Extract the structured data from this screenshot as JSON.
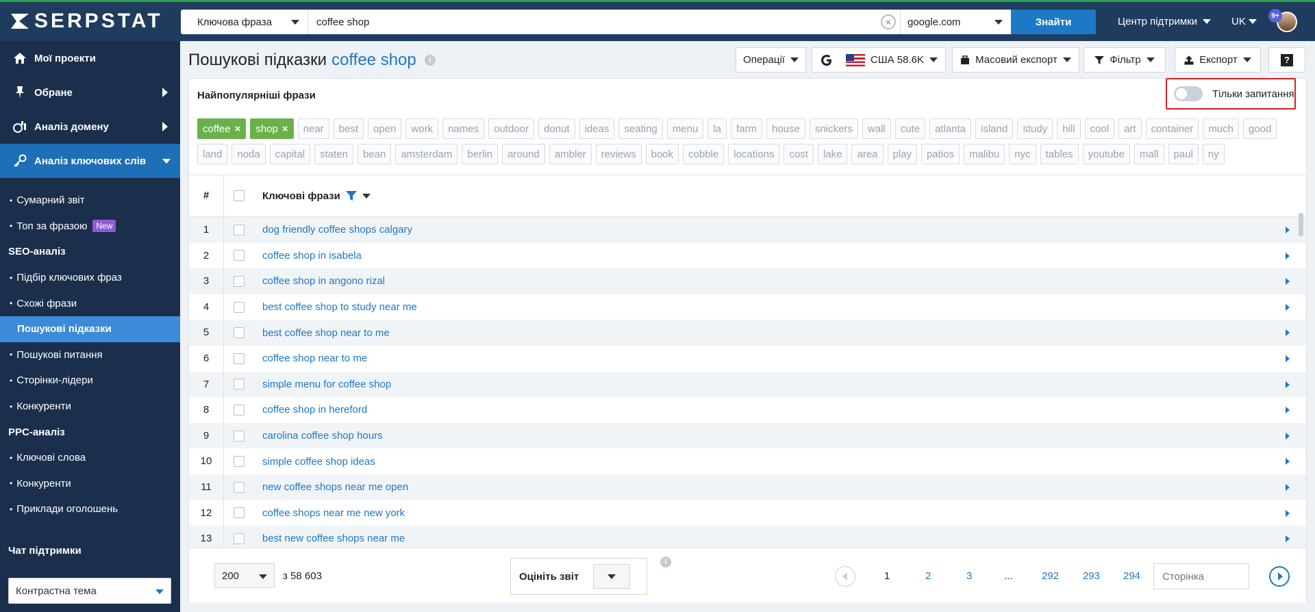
{
  "app": {
    "logo": "SERPSTAT"
  },
  "search": {
    "type": "Ключова фраза",
    "query": "coffee shop",
    "engine": "google.com",
    "button": "Знайти"
  },
  "topnav": {
    "support": "Центр підтримки",
    "lang": "UK",
    "notifications": "9+"
  },
  "sidebar": {
    "main": [
      {
        "label": "Мої проекти",
        "icon": "home-icon"
      },
      {
        "label": "Обране",
        "icon": "pin-icon"
      },
      {
        "label": "Аналіз домену",
        "icon": "chart-icon"
      },
      {
        "label": "Аналіз ключових слів",
        "icon": "key-icon"
      }
    ],
    "sub": [
      {
        "label": "Сумарний звіт"
      },
      {
        "label": "Топ за фразою",
        "badge": "New"
      },
      {
        "group": "SEO-аналіз"
      },
      {
        "label": "Підбір ключових фраз"
      },
      {
        "label": "Схожі фрази"
      },
      {
        "label": "Пошукові підказки",
        "active": true
      },
      {
        "label": "Пошукові питання"
      },
      {
        "label": "Сторінки-лідери"
      },
      {
        "label": "Конкуренти"
      },
      {
        "group": "PPC-аналіз"
      },
      {
        "label": "Ключові слова"
      },
      {
        "label": "Конкуренти"
      },
      {
        "label": "Приклади оголошень"
      }
    ],
    "chat": "Чат підтримки",
    "theme": "Контрастна тема"
  },
  "page": {
    "title": "Пошукові підказки",
    "keyword": "coffee shop",
    "toolbar": {
      "operations": "Операції",
      "region": "США 58.6K",
      "mass_export": "Масовий експорт",
      "filter": "Фільтр",
      "export": "Експорт",
      "help": "?"
    }
  },
  "card": {
    "heading": "Найпопулярніші фрази",
    "toggle_label": "Тільки запитання",
    "selected_tags": [
      "coffee",
      "shop"
    ],
    "tags_row1": [
      "near",
      "best",
      "open",
      "work",
      "names",
      "outdoor",
      "donut",
      "ideas",
      "seating",
      "menu",
      "la",
      "farm",
      "house",
      "snickers",
      "wall",
      "cute",
      "atlanta",
      "island",
      "study",
      "hill",
      "cool",
      "art",
      "container",
      "much",
      "good"
    ],
    "tags_row2": [
      "land",
      "noda",
      "capital",
      "staten",
      "bean",
      "amsterdam",
      "berlin",
      "around",
      "ambler",
      "reviews",
      "book",
      "cobble",
      "locations",
      "cost",
      "lake",
      "area",
      "play",
      "patios",
      "malibu",
      "nyc",
      "tables",
      "youtube",
      "mall",
      "paul",
      "ny"
    ]
  },
  "table": {
    "col_num": "#",
    "col_kw": "Ключові фрази",
    "rows": [
      "dog friendly coffee shops calgary",
      "coffee shop in isabela",
      "coffee shop in angono rizal",
      "best coffee shop to study near me",
      "best coffee shop near to me",
      "coffee shop near to me",
      "simple menu for coffee shop",
      "coffee shop in hereford",
      "carolina coffee shop hours",
      "simple coffee shop ideas",
      "new coffee shops near me open",
      "coffee shops near me new york",
      "best new coffee shops near me"
    ]
  },
  "footer": {
    "per_page": "200",
    "total": "з 58 603",
    "rate": "Оцініть звіт",
    "pages": [
      "1",
      "2",
      "3",
      "...",
      "292",
      "293",
      "294"
    ],
    "page_placeholder": "Сторінка"
  },
  "colors": {
    "accent": "#1d78c6",
    "sidebar": "#1b2f4c",
    "tag_selected": "#6ab04c",
    "highlight": "#d21f24"
  }
}
